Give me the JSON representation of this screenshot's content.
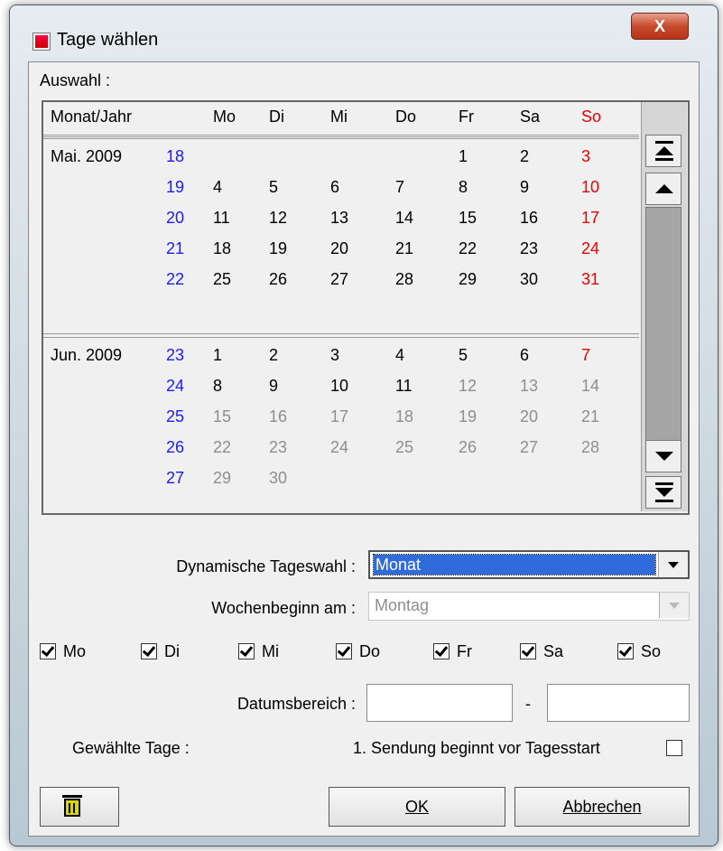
{
  "window": {
    "title": "Tage wählen",
    "close_label": "X"
  },
  "selection_label": "Auswahl :",
  "calendar": {
    "headers": [
      "Monat/Jahr",
      "Mo",
      "Di",
      "Mi",
      "Do",
      "Fr",
      "Sa",
      "So"
    ],
    "months": [
      {
        "label": "Mai. 2009",
        "weeks": [
          {
            "week": "18",
            "days": [
              "",
              "",
              "",
              "",
              "1",
              "2",
              "3"
            ]
          },
          {
            "week": "19",
            "days": [
              "4",
              "5",
              "6",
              "7",
              "8",
              "9",
              "10"
            ]
          },
          {
            "week": "20",
            "days": [
              "11",
              "12",
              "13",
              "14",
              "15",
              "16",
              "17"
            ]
          },
          {
            "week": "21",
            "days": [
              "18",
              "19",
              "20",
              "21",
              "22",
              "23",
              "24"
            ]
          },
          {
            "week": "22",
            "days": [
              "25",
              "26",
              "27",
              "28",
              "29",
              "30",
              "31"
            ]
          }
        ],
        "dimmed_from": 99
      },
      {
        "label": "Jun. 2009",
        "weeks": [
          {
            "week": "23",
            "days": [
              "1",
              "2",
              "3",
              "4",
              "5",
              "6",
              "7"
            ]
          },
          {
            "week": "24",
            "days": [
              "8",
              "9",
              "10",
              "11",
              "12",
              "13",
              "14"
            ]
          },
          {
            "week": "25",
            "days": [
              "15",
              "16",
              "17",
              "18",
              "19",
              "20",
              "21"
            ]
          },
          {
            "week": "26",
            "days": [
              "22",
              "23",
              "24",
              "25",
              "26",
              "27",
              "28"
            ]
          },
          {
            "week": "27",
            "days": [
              "29",
              "30",
              "",
              "",
              "",
              "",
              ""
            ]
          }
        ],
        "dimmed_from": 12
      }
    ]
  },
  "colors": {
    "week_number": "#1b1bff",
    "sunday": "#ee0000",
    "dimmed": "#8e8e8e",
    "selection": "#2f6bdb"
  },
  "dynamic_label": "Dynamische Tageswahl :",
  "dynamic_value": "Monat",
  "week_start_label": "Wochenbeginn am :",
  "week_start_value": "Montag",
  "weekdays": [
    {
      "label": "Mo",
      "checked": true
    },
    {
      "label": "Di",
      "checked": true
    },
    {
      "label": "Mi",
      "checked": true
    },
    {
      "label": "Do",
      "checked": true
    },
    {
      "label": "Fr",
      "checked": true
    },
    {
      "label": "Sa",
      "checked": true
    },
    {
      "label": "So",
      "checked": true
    }
  ],
  "date_range_label": "Datumsbereich :",
  "date_range_separator": "-",
  "date_from": "",
  "date_to": "",
  "selected_days_label": "Gewählte Tage :",
  "broadcast_label": "1. Sendung beginnt vor Tagesstart",
  "broadcast_checked": false,
  "ok_label": "OK",
  "cancel_label": "Abbrechen",
  "icons": {
    "app": "app-icon",
    "trash": "trash-icon"
  }
}
